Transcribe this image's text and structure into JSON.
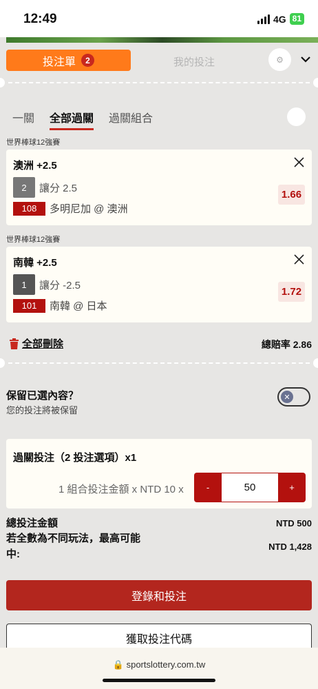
{
  "status": {
    "time": "12:49",
    "network": "4G",
    "battery": "81"
  },
  "header": {
    "betslip_label": "投注單",
    "betslip_count": "2",
    "my_bets_label": "我的投注"
  },
  "subtabs": [
    "一關",
    "全部過關",
    "過關組合"
  ],
  "selections": [
    {
      "league": "世界棒球12強賽",
      "title": "澳洲 +2.5",
      "market_no": "2",
      "market": "讓分 2.5",
      "match_no": "108",
      "match": "多明尼加 @ 澳洲",
      "odds": "1.66"
    },
    {
      "league": "世界棒球12強賽",
      "title": "南韓 +2.5",
      "market_no": "1",
      "market": "讓分 -2.5",
      "match_no": "101",
      "match": "南韓 @ 日本",
      "odds": "1.72"
    }
  ],
  "actions": {
    "delete_all": "全部刪除",
    "total_odds_label": "總賠率",
    "total_odds_value": "2.86"
  },
  "retain": {
    "title": "保留已選內容？",
    "subtitle": "您的投注將被保留"
  },
  "parlay": {
    "title": "過關投注（2 投注選項）x1",
    "stake_label": "1 組合投注金額 x NTD 10 x",
    "minus": "-",
    "plus": "+",
    "stake_value": "50"
  },
  "summary": {
    "total_label": "總投注金額",
    "total_value": "NTD 500",
    "max_label_1": "若全數為不同玩法，最高可能",
    "max_label_2": "中:",
    "max_value": "NTD 1,428"
  },
  "buttons": {
    "login_bet": "登錄和投注",
    "get_code": "獲取投注代碼"
  },
  "browser": {
    "url": "sportslottery.com.tw"
  },
  "colors": {
    "accent_orange": "#ff7a1a",
    "brand_red": "#b3110e"
  }
}
